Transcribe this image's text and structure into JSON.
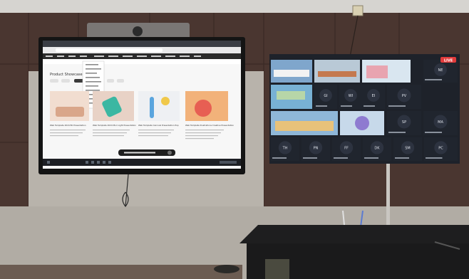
{
  "left_screen": {
    "page_heading": "Product Showcase 2024",
    "cards": [
      {
        "caption": "Web Template 2024 Bli Presentation",
        "thumb_colors": [
          "#f1ddd0",
          "#d9a68a"
        ]
      },
      {
        "caption": "Web Template 2024 Mori Light Presentation",
        "thumb_colors": [
          "#e8d2c6",
          "#3bb7a2"
        ]
      },
      {
        "caption": "Web Template Carnival Presentation Pop",
        "thumb_colors": [
          "#eef0f3",
          "#5aa5de"
        ]
      },
      {
        "caption": "Web Template Illustrations Creative Presentation",
        "thumb_colors": [
          "#f2b27a",
          "#e75f53"
        ]
      }
    ]
  },
  "right_wall": {
    "badge": "LIVE",
    "tile_labels": [
      "NE",
      "GI",
      "WI",
      "EI",
      "PV",
      "SP",
      "MA",
      "TH",
      "PN",
      "FF",
      "DK",
      "SM",
      "PC"
    ]
  },
  "colors": {
    "wall_dark": "#4a3630",
    "screen_bezel": "#141414",
    "tile_dark": "#20252e",
    "badge_red": "#e23b3b"
  }
}
